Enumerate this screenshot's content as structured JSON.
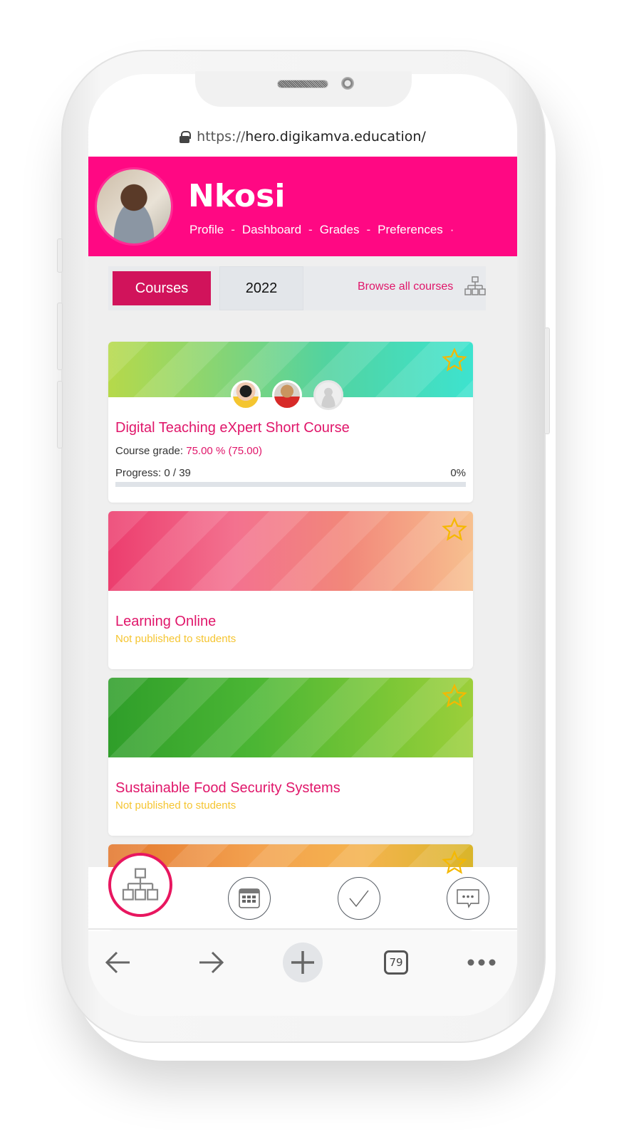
{
  "browser": {
    "url_protocol": "https://",
    "url_host": "hero.digikamva.education/",
    "tab_count": "79"
  },
  "header": {
    "user_name": "Nkosi",
    "nav": [
      {
        "label": "Profile",
        "sep": "-"
      },
      {
        "label": "Dashboard",
        "sep": "-"
      },
      {
        "label": "Grades",
        "sep": "-"
      },
      {
        "label": "Preferences",
        "sep": "·"
      }
    ],
    "accent_color": "#ff0883"
  },
  "tabs": {
    "courses_label": "Courses",
    "year_label": "2022",
    "browse_label": "Browse all courses"
  },
  "courses": [
    {
      "title": "Digital Teaching eXpert Short Course",
      "grade_label": "Course grade:",
      "grade_value": "75.00 % (75.00)",
      "progress_label": "Progress: 0 / 39",
      "progress_percent_label": "0%",
      "progress_fraction": 0,
      "teachers": [
        "teacher-1",
        "teacher-2",
        "teacher-placeholder"
      ],
      "starred": false
    },
    {
      "title": "Learning Online",
      "status": "Not published to students",
      "starred": false
    },
    {
      "title": "Sustainable Food Security Systems",
      "status": "Not published to students",
      "starred": false
    },
    {
      "title": "",
      "starred": false
    }
  ],
  "app_nav": [
    {
      "name": "courses-hierarchy",
      "active": true
    },
    {
      "name": "calendar",
      "active": false
    },
    {
      "name": "tasks-check",
      "active": false
    },
    {
      "name": "messages",
      "active": false
    }
  ],
  "colors": {
    "brand_pink": "#ff0883",
    "course_tab": "#d1135b",
    "link": "#e0166a",
    "status_yellow": "#f5c531"
  }
}
